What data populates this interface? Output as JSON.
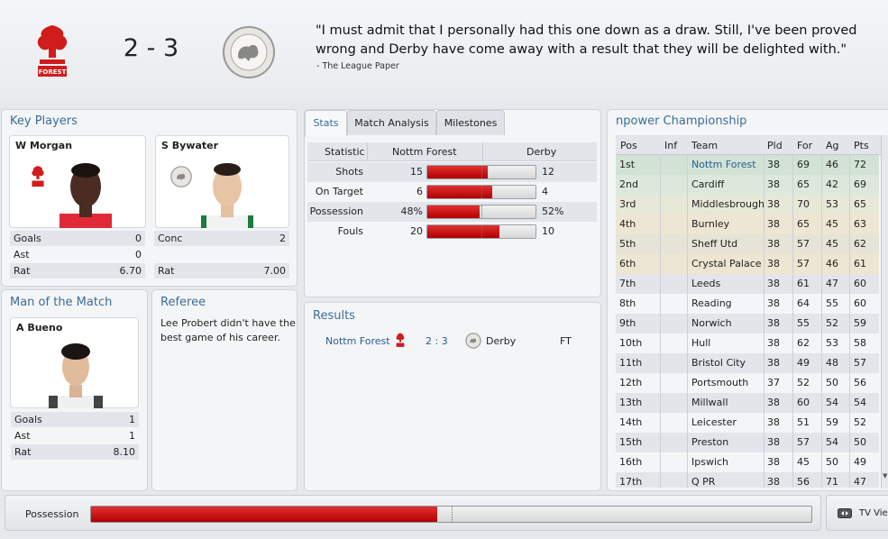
{
  "header": {
    "score": "2 - 3",
    "quote": "\"I must admit that I personally had this one down as a draw. Still, I've been proved wrong and Derby have come away with a result that they will be delighted with.\"",
    "quote_source": "- The League Paper",
    "home_crest_icon": "nottingham-forest-crest-icon",
    "away_crest_icon": "derby-county-crest-icon",
    "away_crest_text": "DERBY COUNTY FOOTBALL CLUB",
    "home_crest_text": "FOREST"
  },
  "key_players": {
    "title": "Key Players",
    "home": {
      "name": "W Morgan",
      "stats": [
        {
          "label": "Goals",
          "value": "0"
        },
        {
          "label": "Ast",
          "value": "0"
        },
        {
          "label": "Rat",
          "value": "6.70"
        }
      ]
    },
    "away": {
      "name": "S Bywater",
      "stats": [
        {
          "label": "Conc",
          "value": "2"
        },
        {
          "label": "",
          "value": ""
        },
        {
          "label": "Rat",
          "value": "7.00"
        }
      ]
    }
  },
  "motm": {
    "title": "Man of the Match",
    "name": "A Bueno",
    "stats": [
      {
        "label": "Goals",
        "value": "1"
      },
      {
        "label": "Ast",
        "value": "1"
      },
      {
        "label": "Rat",
        "value": "8.10"
      }
    ]
  },
  "referee": {
    "title": "Referee",
    "text": "Lee Probert didn't have the best game of his career."
  },
  "tabs": [
    "Stats",
    "Match Analysis",
    "Milestones"
  ],
  "stats_table": {
    "headers": [
      "Statistic",
      "Nottm Forest",
      "Derby"
    ],
    "rows": [
      {
        "name": "Shots",
        "home": "15",
        "away": "12",
        "home_share": 0.556
      },
      {
        "name": "On Target",
        "home": "6",
        "away": "4",
        "home_share": 0.6
      },
      {
        "name": "Possession",
        "home": "48%",
        "away": "52%",
        "home_share": 0.48
      },
      {
        "name": "Fouls",
        "home": "20",
        "away": "10",
        "home_share": 0.667
      }
    ]
  },
  "results": {
    "title": "Results",
    "home": "Nottm Forest",
    "score": "2 : 3",
    "away": "Derby",
    "status": "FT"
  },
  "league": {
    "title": "npower Championship",
    "headers": [
      "Pos",
      "Inf",
      "Team",
      "Pld",
      "For",
      "Ag",
      "Pts"
    ],
    "rows": [
      {
        "pos": "1st",
        "team": "Nottm Forest",
        "pld": "38",
        "for": "69",
        "ag": "46",
        "pts": "72",
        "zone": "#d2e3d6",
        "highlight": true
      },
      {
        "pos": "2nd",
        "team": "Cardiff",
        "pld": "38",
        "for": "65",
        "ag": "42",
        "pts": "69",
        "zone": "#dce8dc"
      },
      {
        "pos": "3rd",
        "team": "Middlesbrough",
        "pld": "38",
        "for": "70",
        "ag": "53",
        "pts": "65",
        "zone": "#e8e8d8"
      },
      {
        "pos": "4th",
        "team": "Burnley",
        "pld": "38",
        "for": "65",
        "ag": "45",
        "pts": "63",
        "zone": "#ece6d2"
      },
      {
        "pos": "5th",
        "team": "Sheff Utd",
        "pld": "38",
        "for": "57",
        "ag": "45",
        "pts": "62",
        "zone": "#e6e4d6"
      },
      {
        "pos": "6th",
        "team": "Crystal Palace",
        "pld": "38",
        "for": "57",
        "ag": "46",
        "pts": "61",
        "zone": "#ece6d2"
      },
      {
        "pos": "7th",
        "team": "Leeds",
        "pld": "38",
        "for": "61",
        "ag": "47",
        "pts": "60",
        "zone": "#e2e5ea"
      },
      {
        "pos": "8th",
        "team": "Reading",
        "pld": "38",
        "for": "64",
        "ag": "55",
        "pts": "60",
        "zone": "#f4f5f7"
      },
      {
        "pos": "9th",
        "team": "Norwich",
        "pld": "38",
        "for": "55",
        "ag": "52",
        "pts": "59",
        "zone": "#e2e5ea"
      },
      {
        "pos": "10th",
        "team": "Hull",
        "pld": "38",
        "for": "62",
        "ag": "53",
        "pts": "58",
        "zone": "#f4f5f7"
      },
      {
        "pos": "11th",
        "team": "Bristol City",
        "pld": "38",
        "for": "49",
        "ag": "48",
        "pts": "57",
        "zone": "#e2e5ea"
      },
      {
        "pos": "12th",
        "team": "Portsmouth",
        "pld": "37",
        "for": "52",
        "ag": "50",
        "pts": "56",
        "zone": "#f4f5f7"
      },
      {
        "pos": "13th",
        "team": "Millwall",
        "pld": "38",
        "for": "60",
        "ag": "54",
        "pts": "54",
        "zone": "#e2e5ea"
      },
      {
        "pos": "14th",
        "team": "Leicester",
        "pld": "38",
        "for": "51",
        "ag": "59",
        "pts": "52",
        "zone": "#f4f5f7"
      },
      {
        "pos": "15th",
        "team": "Preston",
        "pld": "38",
        "for": "57",
        "ag": "54",
        "pts": "50",
        "zone": "#e2e5ea"
      },
      {
        "pos": "16th",
        "team": "Ipswich",
        "pld": "38",
        "for": "45",
        "ag": "50",
        "pts": "49",
        "zone": "#f4f5f7"
      },
      {
        "pos": "17th",
        "team": "Q PR",
        "pld": "38",
        "for": "56",
        "ag": "71",
        "pts": "47",
        "zone": "#e2e5ea"
      }
    ]
  },
  "bottom": {
    "possession_label": "Possession",
    "possession_home_share": 0.48,
    "tv_view_label": "TV View"
  },
  "colors": {
    "accent": "#3a6d9a",
    "bar_red": "#c00000"
  }
}
